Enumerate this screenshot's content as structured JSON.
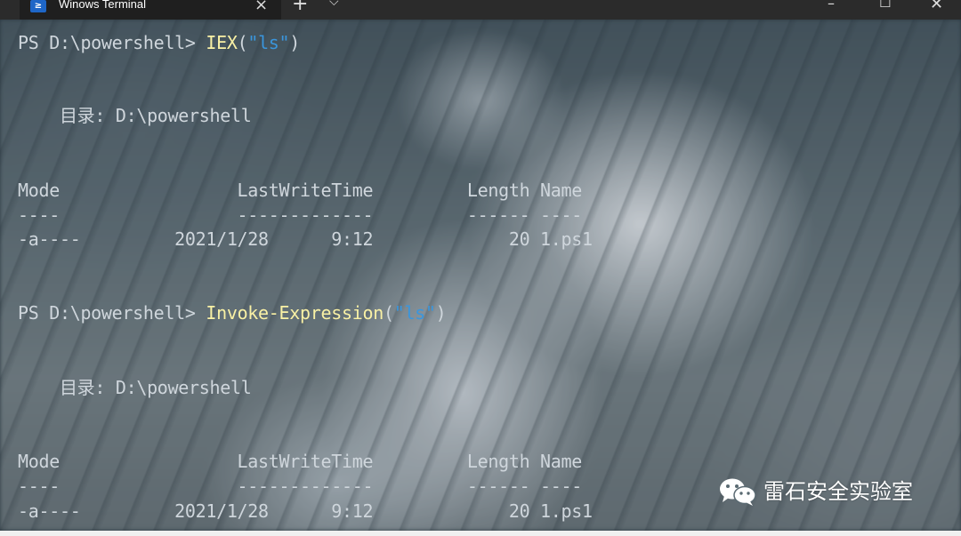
{
  "titlebar": {
    "tab_title": "Winows Terminal",
    "tab_icon_glyph": "≥",
    "tab_close": "×",
    "new_tab": "+",
    "dropdown": "⌵",
    "minimize": "–",
    "maximize": "☐",
    "close": "✕"
  },
  "terminal": {
    "block1": {
      "prompt": "PS D:\\powershell> ",
      "cmd": "IEX",
      "open": "(",
      "str": "\"ls\"",
      "close": ")",
      "dir_label": "    目录: D:\\powershell",
      "header": "Mode                 LastWriteTime         Length Name",
      "dashes": "----                 -------------         ------ ----",
      "row": "-a----         2021/1/28      9:12             20 1.ps1"
    },
    "block2": {
      "prompt": "PS D:\\powershell> ",
      "cmd": "Invoke-Expression",
      "open": "(",
      "str": "\"ls\"",
      "close": ")",
      "dir_label": "    目录: D:\\powershell",
      "header": "Mode                 LastWriteTime         Length Name",
      "dashes": "----                 -------------         ------ ----",
      "row": "-a----         2021/1/28      9:12             20 1.ps1"
    }
  },
  "watermark": {
    "text": "雷石安全实验室",
    "icon": "wechat-icon"
  },
  "colors": {
    "command": "#f9f1a5",
    "string": "#3a96dd",
    "text": "#cfd6dc",
    "tab_icon": "#1e66c7"
  }
}
